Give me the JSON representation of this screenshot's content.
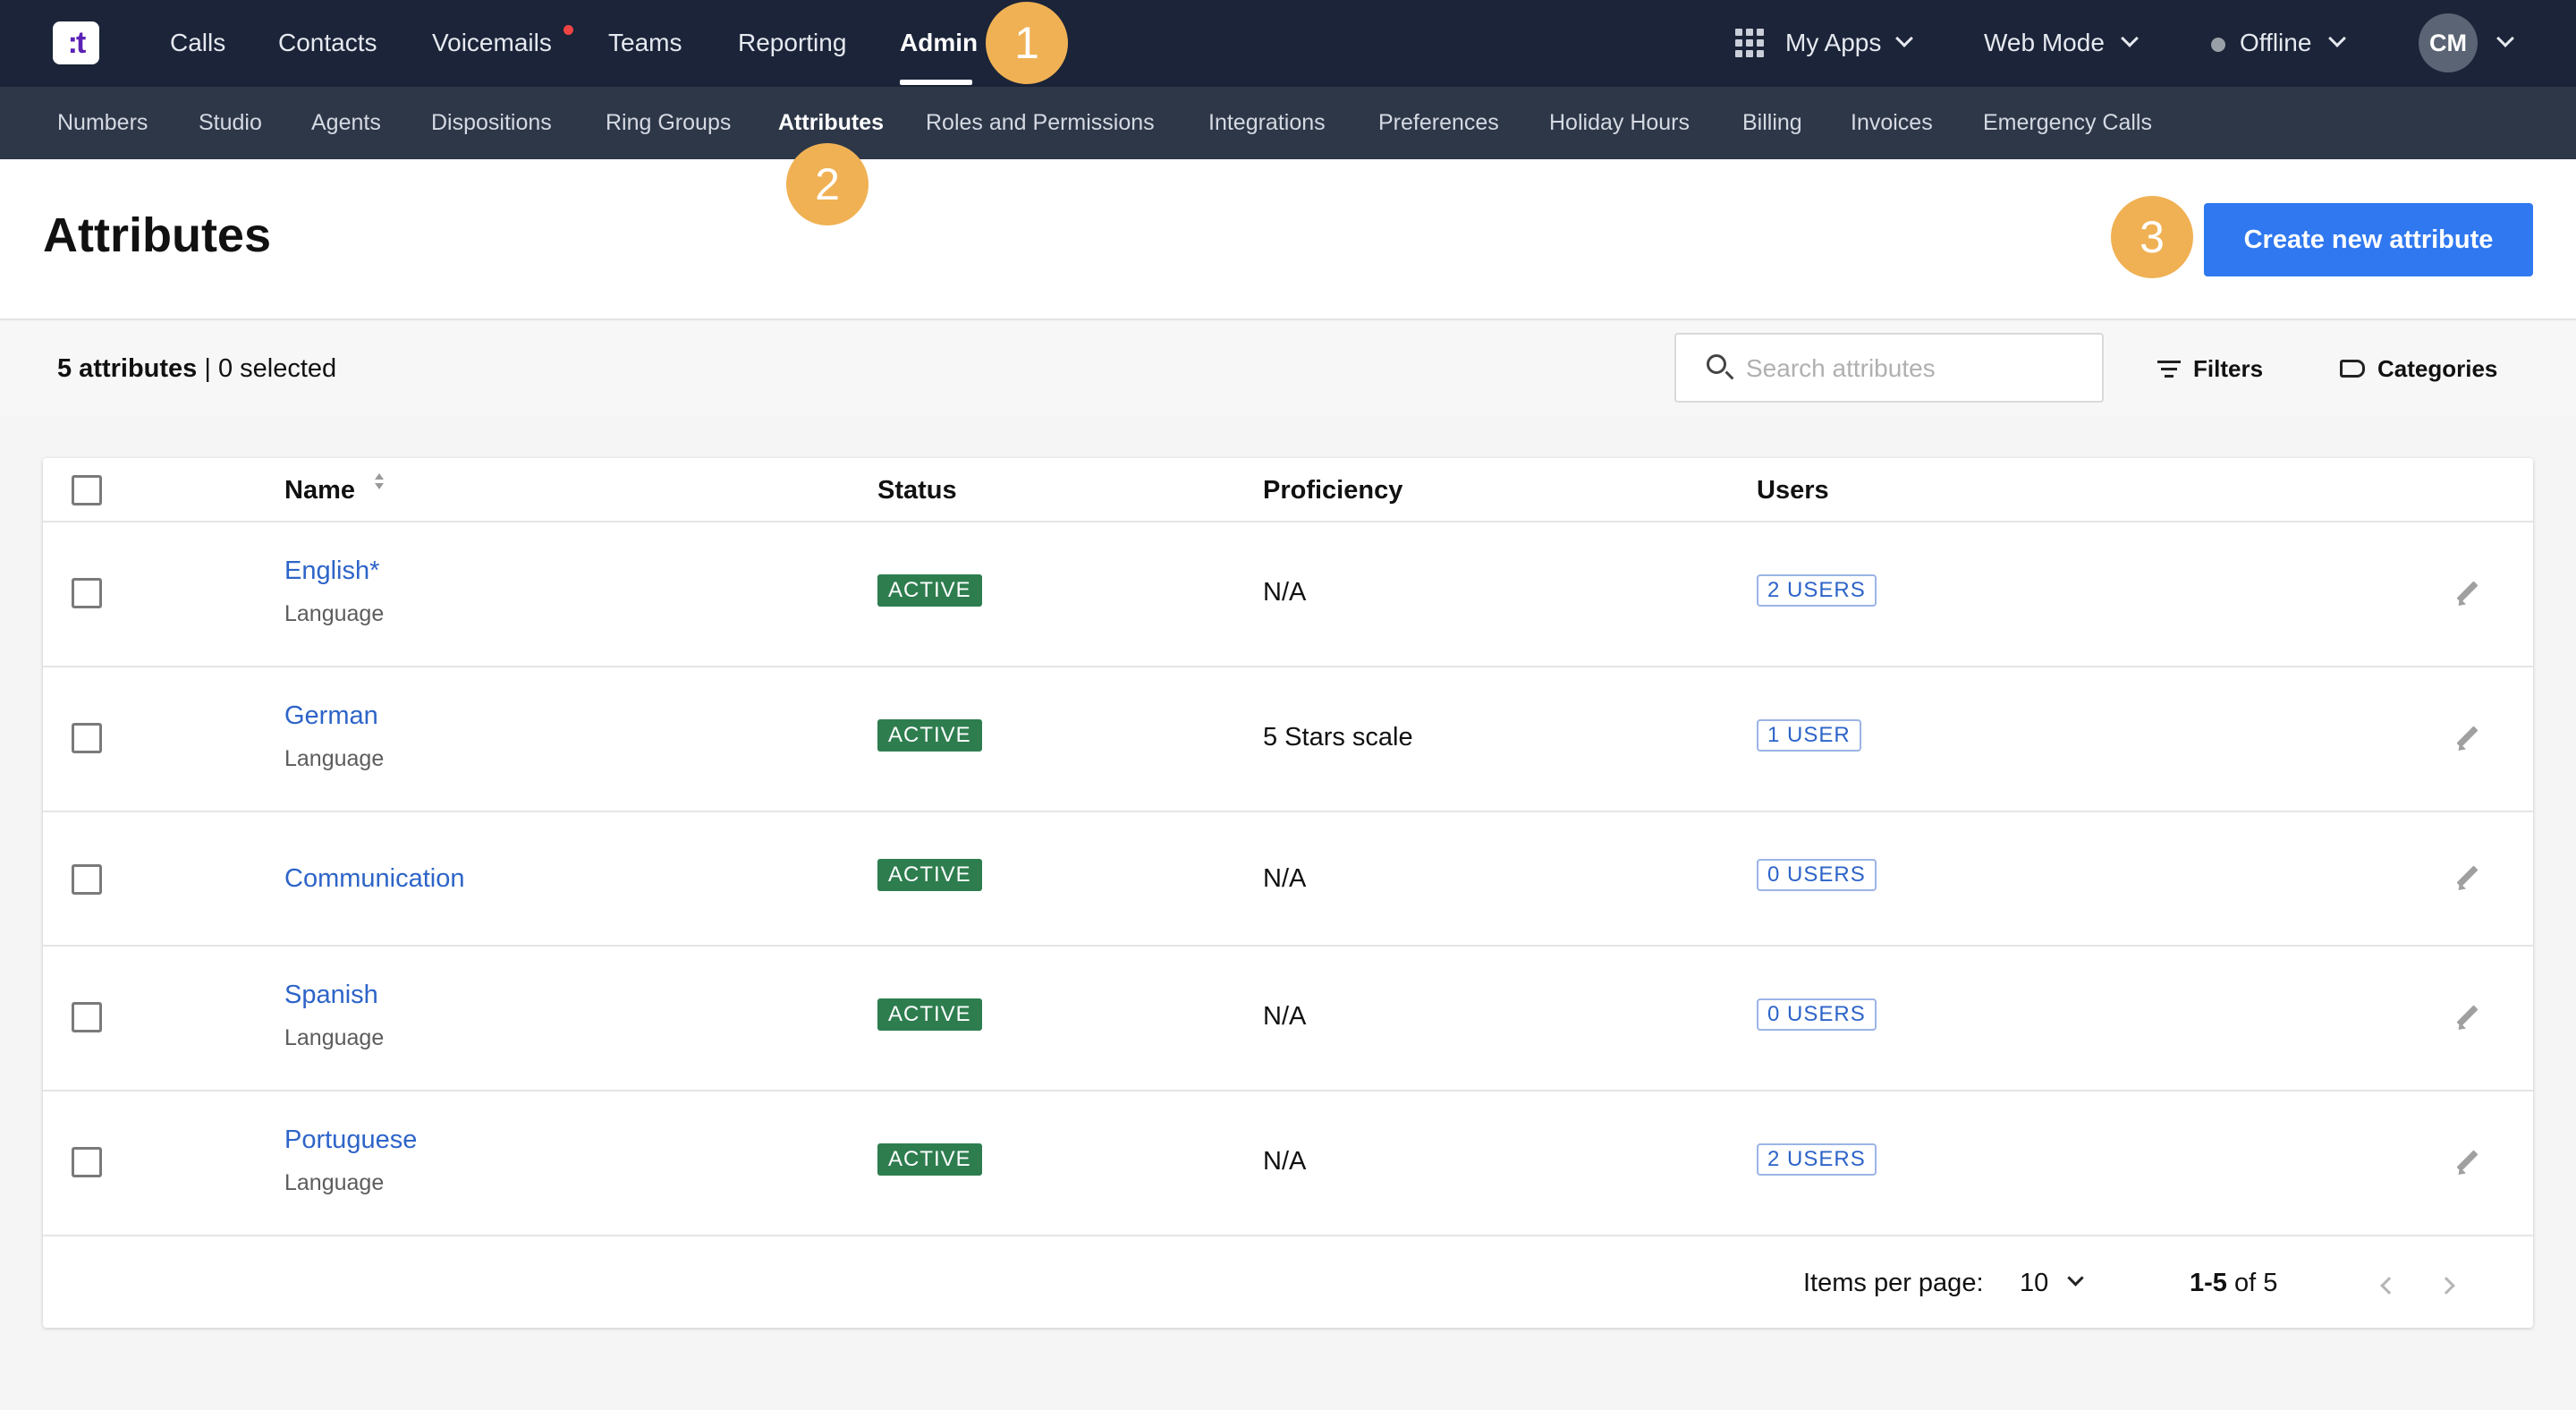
{
  "topnav": {
    "logo": ":t",
    "items": [
      "Calls",
      "Contacts",
      "Voicemails",
      "Teams",
      "Reporting",
      "Admin"
    ],
    "active": "Admin",
    "my_apps": "My Apps",
    "web_mode": "Web Mode",
    "status": "Offline",
    "avatar": "CM"
  },
  "subnav": {
    "items": [
      "Numbers",
      "Studio",
      "Agents",
      "Dispositions",
      "Ring Groups",
      "Attributes",
      "Roles and Permissions",
      "Integrations",
      "Preferences",
      "Holiday Hours",
      "Billing",
      "Invoices",
      "Emergency Calls"
    ],
    "active": "Attributes"
  },
  "badges": [
    "1",
    "2",
    "3"
  ],
  "header": {
    "title": "Attributes",
    "create_button": "Create new attribute"
  },
  "toolbar": {
    "count": "5 attributes",
    "separator": " | ",
    "selected": "0 selected",
    "search_placeholder": "Search attributes",
    "filters": "Filters",
    "categories": "Categories"
  },
  "table": {
    "columns": [
      "Name",
      "Status",
      "Proficiency",
      "Users"
    ],
    "rows": [
      {
        "name": "English*",
        "category": "Language",
        "status": "ACTIVE",
        "proficiency": "N/A",
        "users": "2 USERS"
      },
      {
        "name": "German",
        "category": "Language",
        "status": "ACTIVE",
        "proficiency": "5 Stars scale",
        "users": "1 USER"
      },
      {
        "name": "Communication",
        "category": "",
        "status": "ACTIVE",
        "proficiency": "N/A",
        "users": "0 USERS"
      },
      {
        "name": "Spanish",
        "category": "Language",
        "status": "ACTIVE",
        "proficiency": "N/A",
        "users": "0 USERS"
      },
      {
        "name": "Portuguese",
        "category": "Language",
        "status": "ACTIVE",
        "proficiency": "N/A",
        "users": "2 USERS"
      }
    ]
  },
  "pagination": {
    "label": "Items per page:",
    "per_page": "10",
    "range": "1-5",
    "of": " of 5"
  },
  "colors": {
    "topnav_bg": "#1b2438",
    "subnav_bg": "#2d3748",
    "primary": "#2f78f0",
    "active_status": "#2e7d4f",
    "link": "#2d64c8",
    "badge": "#f0b154"
  }
}
